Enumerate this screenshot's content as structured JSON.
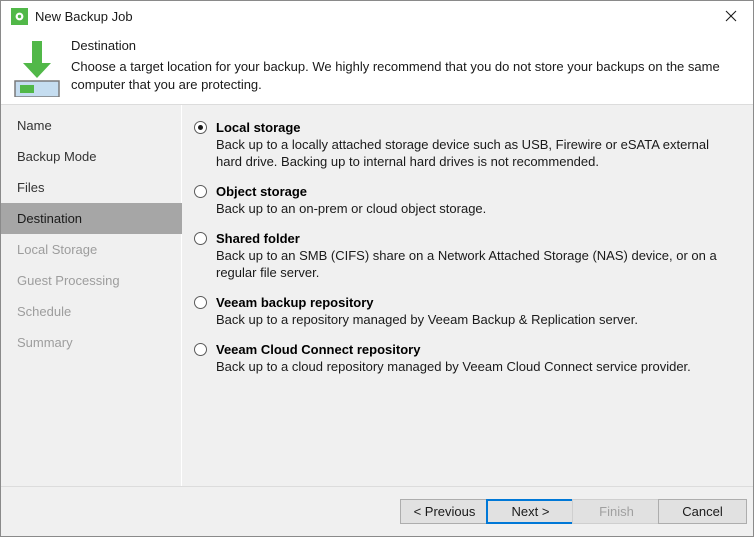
{
  "window": {
    "title": "New Backup Job",
    "app_icon": "gear-icon",
    "close_icon": "close-icon",
    "accent_color": "#51b848",
    "focus_color": "#0078d7"
  },
  "header": {
    "title": "Destination",
    "description": "Choose a target location for your backup. We highly recommend that you do not store your backups on the same computer that you are protecting.",
    "icon": "download-to-storage-icon"
  },
  "sidebar": {
    "items": [
      {
        "label": "Name",
        "state": "visited"
      },
      {
        "label": "Backup Mode",
        "state": "visited"
      },
      {
        "label": "Files",
        "state": "visited"
      },
      {
        "label": "Destination",
        "state": "selected"
      },
      {
        "label": "Local Storage",
        "state": "upcoming"
      },
      {
        "label": "Guest Processing",
        "state": "upcoming"
      },
      {
        "label": "Schedule",
        "state": "upcoming"
      },
      {
        "label": "Summary",
        "state": "upcoming"
      }
    ]
  },
  "main": {
    "options": [
      {
        "label": "Local storage",
        "description": "Back up to a locally attached storage device such as USB, Firewire or eSATA external hard drive. Backing up to internal hard drives is not recommended.",
        "selected": true
      },
      {
        "label": "Object storage",
        "description": "Back up to an on-prem or cloud object storage.",
        "selected": false
      },
      {
        "label": "Shared folder",
        "description": "Back up to an SMB (CIFS) share on a Network Attached Storage (NAS) device, or on a regular file server.",
        "selected": false
      },
      {
        "label": "Veeam backup repository",
        "description": "Back up to a repository managed by Veeam Backup & Replication server.",
        "selected": false
      },
      {
        "label": "Veeam Cloud Connect repository",
        "description": "Back up to a cloud repository managed by Veeam Cloud Connect service provider.",
        "selected": false
      }
    ]
  },
  "footer": {
    "previous_label": "< Previous",
    "next_label": "Next >",
    "finish_label": "Finish",
    "cancel_label": "Cancel"
  }
}
